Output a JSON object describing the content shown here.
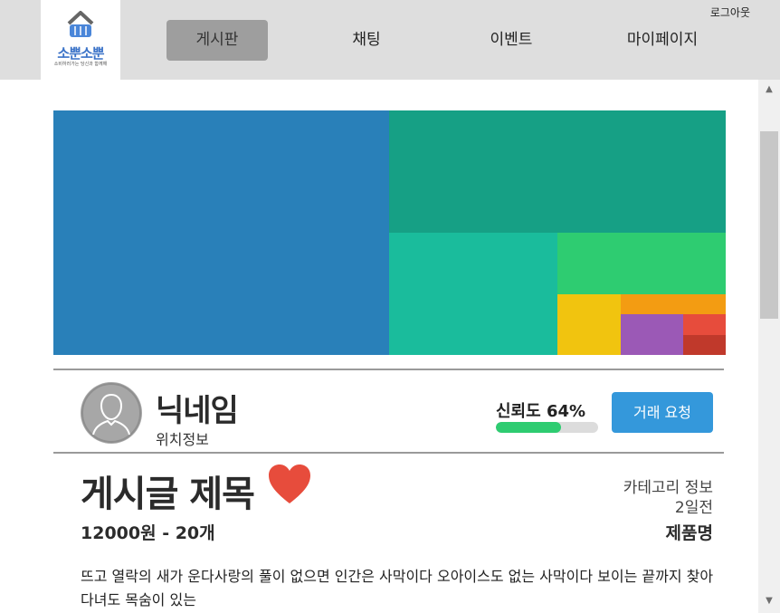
{
  "header": {
    "logo": {
      "title": "소뿐소뿐",
      "tagline": "소비하러가는 당신과 함께해"
    },
    "nav": [
      {
        "label": "게시판",
        "active": true
      },
      {
        "label": "채팅",
        "active": false
      },
      {
        "label": "이벤트",
        "active": false
      },
      {
        "label": "마이페이지",
        "active": false
      }
    ],
    "logout_label": "로그아웃"
  },
  "hero": {
    "tile_colors": [
      "#2980b9",
      "#16a085",
      "#1abc9c",
      "#2ecc71",
      "#f1c40f",
      "#f39c12",
      "#9b59b6",
      "#e74c3c",
      "#c0392b"
    ]
  },
  "seller": {
    "nickname": "닉네임",
    "location": "위치정보",
    "trust_label": "신뢰도 64%",
    "trust_value": 0.64,
    "trade_button": "거래 요청"
  },
  "post": {
    "title": "게시글 제목",
    "price_qty": "12000원 - 20개",
    "category": "카테고리 정보",
    "time": "2일전",
    "product": "제품명",
    "body": "뜨고 열락의 새가 운다사랑의 풀이 없으면 인간은 사막이다 오아이스도 없는 사막이다 보이는 끝까지 찾아다녀도 목숨이 있는"
  },
  "colors": {
    "accent": "#3498db",
    "heart": "#e74c3c",
    "trust_fill": "#2ecc71"
  }
}
